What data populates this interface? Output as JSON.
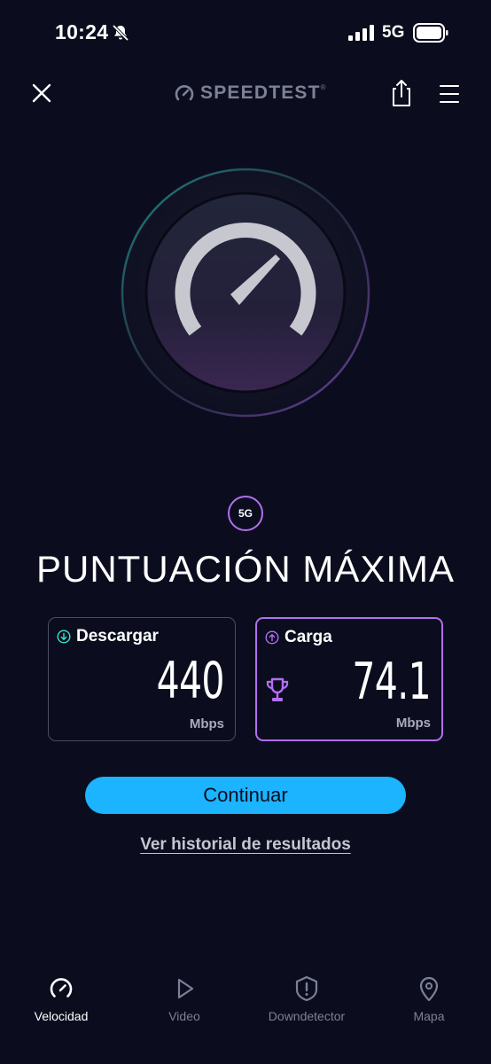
{
  "status_bar": {
    "time": "10:24",
    "network": "5G",
    "icons": [
      "bell-slash-icon",
      "signal-icon",
      "battery-icon"
    ]
  },
  "header": {
    "brand": "SPEEDTEST",
    "brand_mark": "®",
    "icons": [
      "close-icon",
      "gauge-icon",
      "share-icon",
      "menu-icon"
    ]
  },
  "badge": "5G",
  "score_title": "PUNTUACIÓN MÁXIMA",
  "download": {
    "label": "Descargar",
    "value": "440",
    "unit": "Mbps",
    "icon": "arrow-down-circle-icon",
    "accent": "#2ee8d0"
  },
  "upload": {
    "label": "Carga",
    "value": "74.1",
    "unit": "Mbps",
    "icon": "arrow-up-circle-icon",
    "accent": "#b16ff0"
  },
  "continue_button": "Continuar",
  "history_link": "Ver historial de resultados",
  "tabs": [
    {
      "label": "Velocidad",
      "icon": "speedometer-icon",
      "active": true
    },
    {
      "label": "Video",
      "icon": "play-icon",
      "active": false
    },
    {
      "label": "Downdetector",
      "icon": "alert-badge-icon",
      "active": false
    },
    {
      "label": "Mapa",
      "icon": "map-pin-icon",
      "active": false
    }
  ],
  "colors": {
    "background": "#0b0d1e",
    "accent_blue": "#1cb3ff",
    "accent_purple": "#b16ff0",
    "accent_teal": "#2ee8d0"
  }
}
